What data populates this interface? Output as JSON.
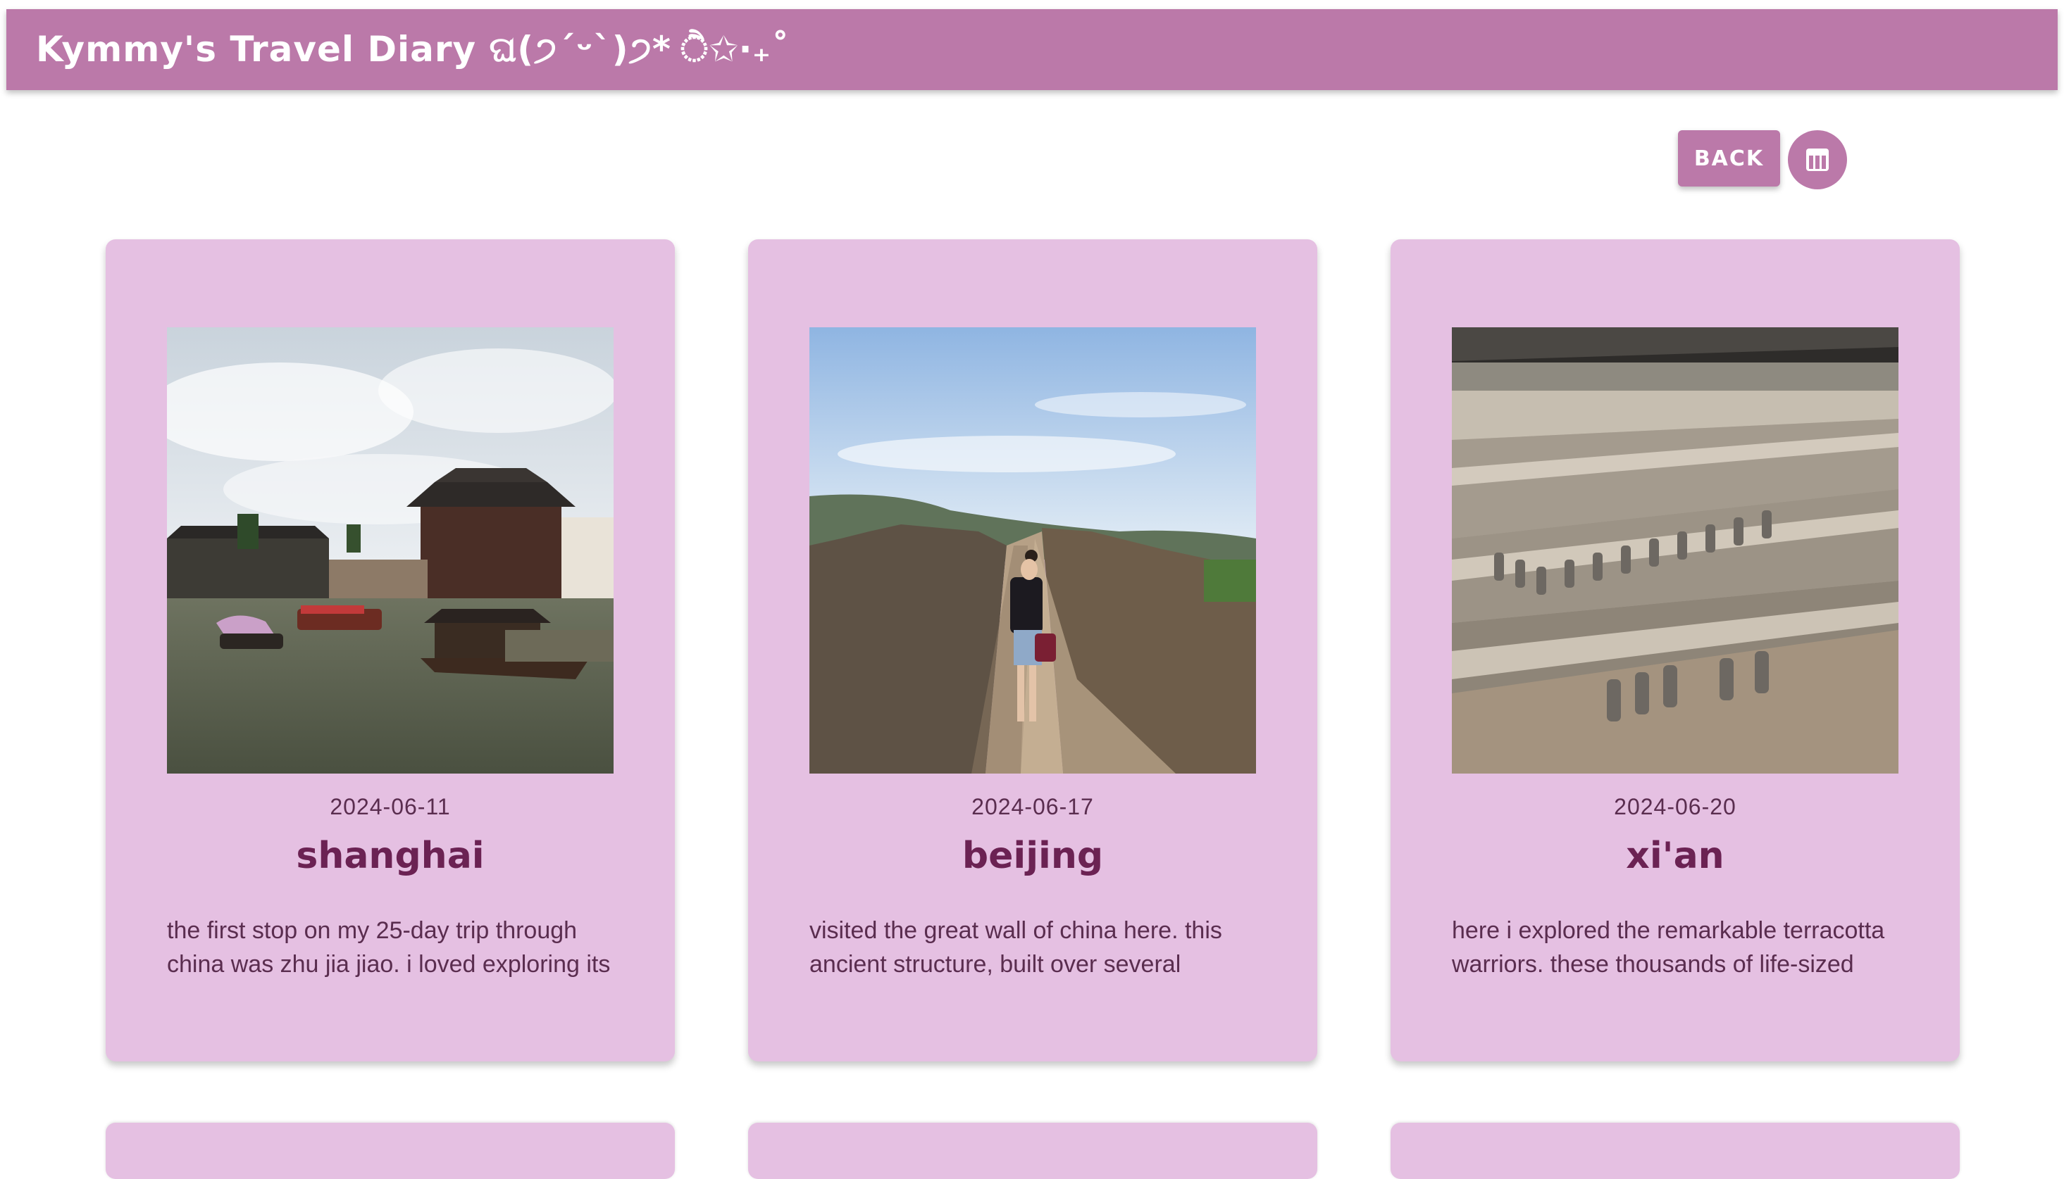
{
  "header": {
    "title": "Kymmy's Travel Diary ଘ(੭ˊᵕˋ)੭* ੈ✩‧₊˚"
  },
  "toolbar": {
    "back_label": "BACK",
    "grid_icon": "grid-view-icon"
  },
  "colors": {
    "accent": "#bb79a9",
    "card": "#e5c0e2",
    "title_text": "#6b2253"
  },
  "entries": [
    {
      "date": "2024-06-11",
      "city": "shanghai",
      "description": "the first stop on my 25-day trip through china was zhu jia jiao. i loved exploring its ancient architecture and"
    },
    {
      "date": "2024-06-17",
      "city": "beijing",
      "description": "visited the great wall of china here. this ancient structure, built over several dynasties to protect against invasions."
    },
    {
      "date": "2024-06-20",
      "city": "xi'an",
      "description": "here i explored the remarkable terracotta warriors. these thousands of life-sized statues, buried for over"
    }
  ]
}
